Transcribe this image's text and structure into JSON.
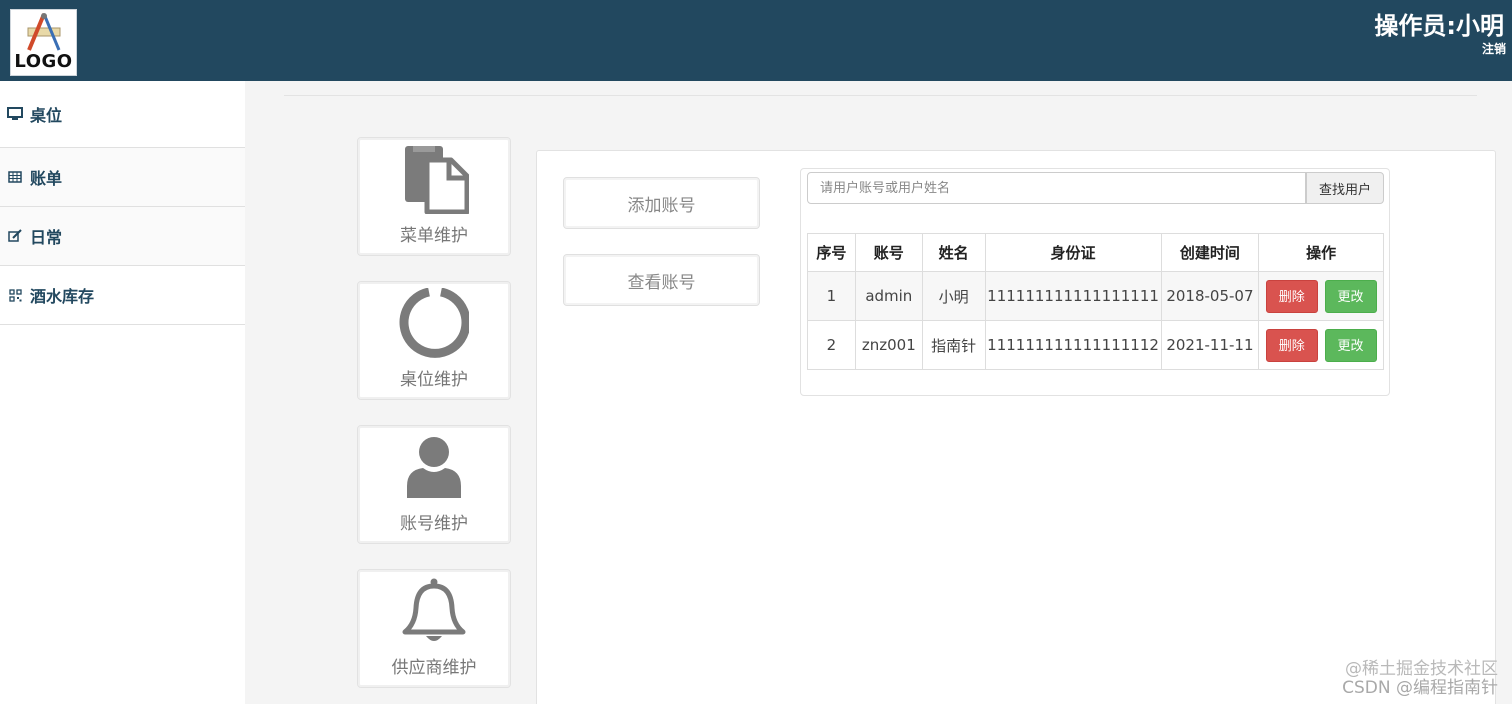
{
  "header": {
    "logo_text": "LOGO",
    "operator": "操作员:小明",
    "logout": "注销"
  },
  "sidebar": {
    "items": [
      {
        "label": "桌位",
        "icon": "monitor-icon"
      },
      {
        "label": "账单",
        "icon": "table-icon"
      },
      {
        "label": "日常",
        "icon": "edit-icon"
      },
      {
        "label": "酒水库存",
        "icon": "qrcode-icon"
      }
    ]
  },
  "tiles": [
    {
      "label": "菜单维护",
      "icon": "document-icon"
    },
    {
      "label": "桌位维护",
      "icon": "ring-icon"
    },
    {
      "label": "账号维护",
      "icon": "user-icon"
    },
    {
      "label": "供应商维护",
      "icon": "bell-icon"
    }
  ],
  "actions": {
    "add_account": "添加账号",
    "view_account": "查看账号"
  },
  "search": {
    "placeholder": "请用户账号或用户姓名",
    "button": "查找用户"
  },
  "table": {
    "headers": [
      "序号",
      "账号",
      "姓名",
      "身份证",
      "创建时间",
      "操作"
    ],
    "rows": [
      {
        "no": "1",
        "account": "admin",
        "name": "小明",
        "id_card": "111111111111111111",
        "created": "2018-05-07"
      },
      {
        "no": "2",
        "account": "znz001",
        "name": "指南针",
        "id_card": "111111111111111112",
        "created": "2021-11-11"
      }
    ],
    "delete_label": "删除",
    "edit_label": "更改"
  },
  "watermark": {
    "line1": "@稀土掘金技术社区",
    "line2": "CSDN @编程指南针"
  },
  "colors": {
    "header_bg": "#22485f",
    "danger": "#d9534f",
    "success": "#5cb85c"
  }
}
